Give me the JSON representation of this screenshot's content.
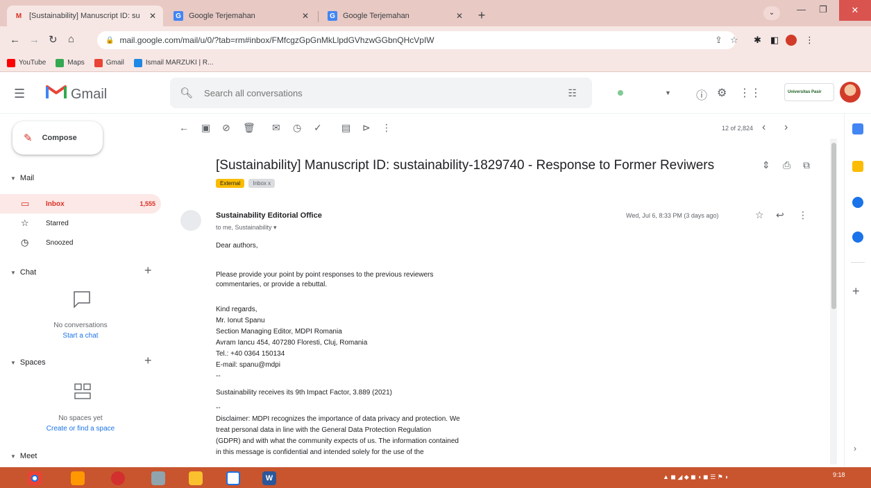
{
  "browser": {
    "tabs": [
      {
        "title": "[Sustainability] Manuscript ID: su",
        "active": true
      },
      {
        "title": "Google Terjemahan",
        "active": false
      },
      {
        "title": "Google Terjemahan",
        "active": false
      }
    ],
    "url": "mail.google.com/mail/u/0/?tab=rm#inbox/FMfcgzGpGnMkLlpdGVhzwGGbnQHcVpIW",
    "bookmarks": [
      "YouTube",
      "Maps",
      "Gmail",
      "Ismail MARZUKI | R..."
    ]
  },
  "gmail": {
    "app_name": "Gmail",
    "search_placeholder": "Search all conversations",
    "compose_label": "Compose",
    "sections": {
      "mail": "Mail",
      "chat": "Chat",
      "spaces": "Spaces",
      "meet": "Meet"
    },
    "nav": [
      {
        "label": "Inbox",
        "count": "1,555"
      },
      {
        "label": "Starred",
        "count": ""
      },
      {
        "label": "Snoozed",
        "count": ""
      }
    ],
    "chat_empty": "No conversations",
    "chat_link": "Start a chat",
    "spaces_empty": "No spaces yet",
    "spaces_link": "Create or find a space",
    "pager": "12 of 2,824",
    "org_logo": "Universitas Pasir"
  },
  "message": {
    "subject": "[Sustainability] Manuscript ID: sustainability-1829740 - Response to Former Reviwers",
    "labels": [
      "External",
      "Inbox x"
    ],
    "sender": "Sustainability Editorial Office",
    "to": "to me, Sustainability",
    "date": "Wed, Jul 6, 8:33 PM (3 days ago)",
    "body_lines": [
      "Dear authors,",
      "",
      "Please provide your point by point responses to the previous reviewers",
      "commentaries, or provide a rebuttal.",
      "",
      "Kind regards,",
      "Mr. Ionut Spanu",
      "Section Managing Editor, MDPI Romania",
      "Avram Iancu 454, 407280 Floresti, Cluj, Romania",
      "Tel.: +40 0364 150134",
      "E-mail: spanu@mdpi",
      "--",
      "Sustainability receives its 9th Impact Factor, 3.889 (2021)",
      "--",
      "Disclaimer: MDPI recognizes the importance of data privacy and protection. We",
      "treat personal data in line with the General Data Protection Regulation",
      "(GDPR) and with what the community expects of us. The information contained",
      "in this message is confidential and intended solely for the use of the"
    ]
  },
  "taskbar": {
    "time": "9:18"
  },
  "colors": {
    "accent": "#d93025",
    "browser_frame": "#e8c9c4",
    "taskbar": "#c8552e"
  }
}
